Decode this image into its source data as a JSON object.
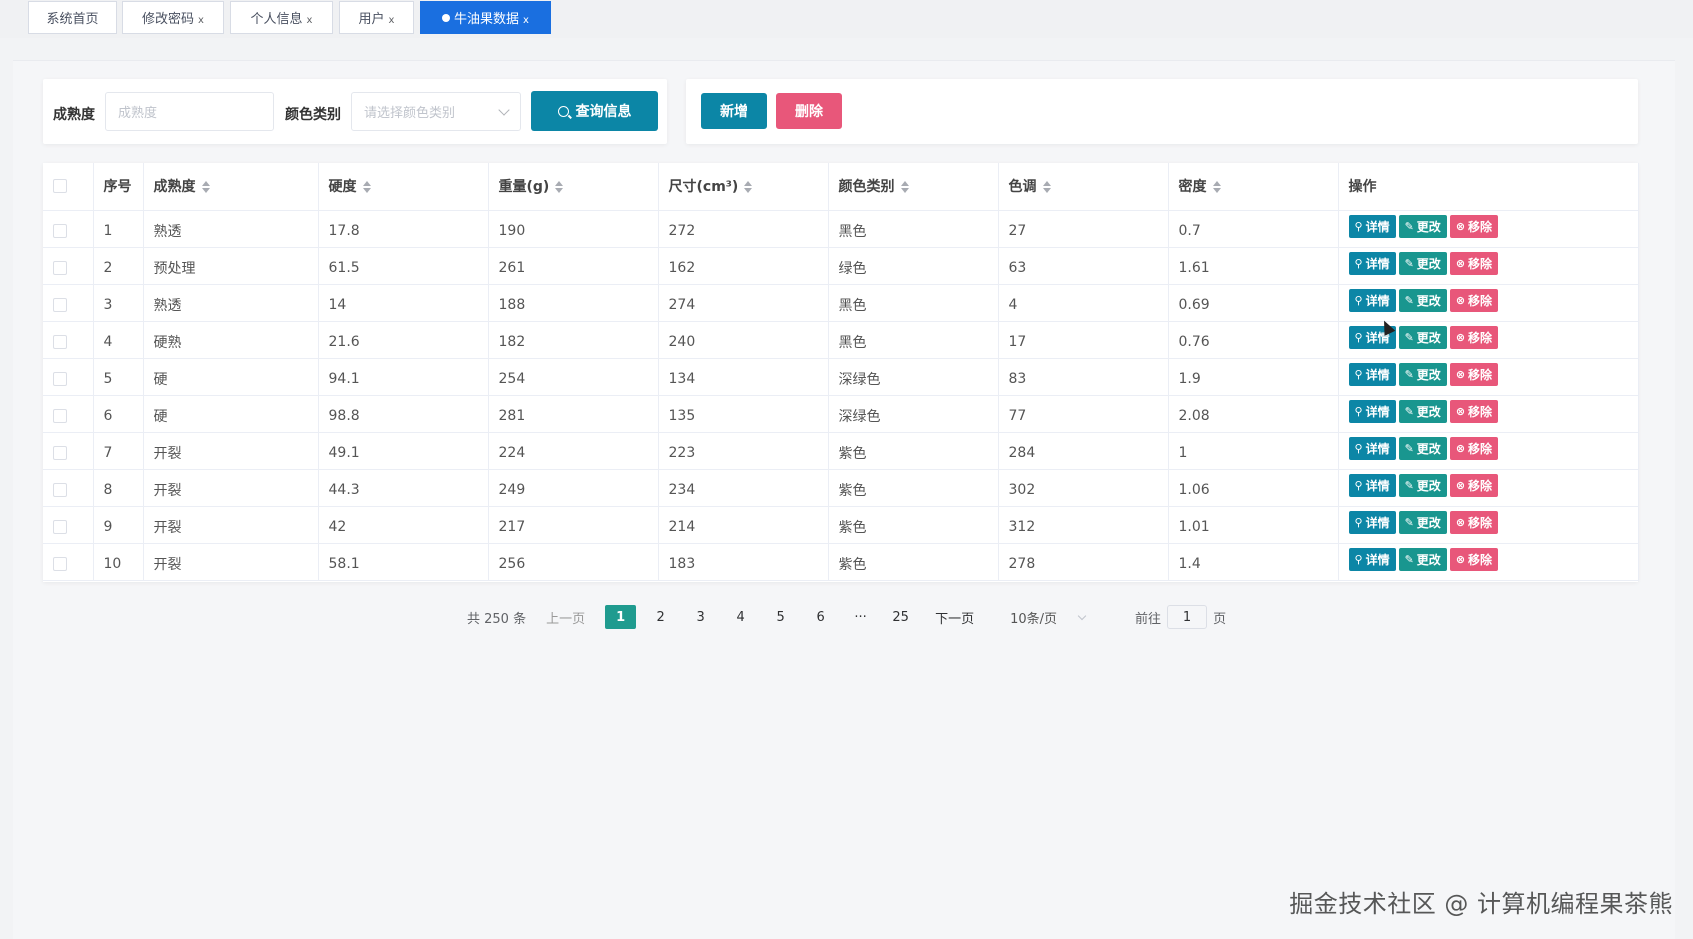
{
  "tabs": [
    {
      "label": "系统首页",
      "closable": false
    },
    {
      "label": "修改密码",
      "closable": true
    },
    {
      "label": "个人信息",
      "closable": true
    },
    {
      "label": "用户",
      "closable": true
    },
    {
      "label": "牛油果数据",
      "closable": true,
      "active": true
    }
  ],
  "tab_close_glyph": "x",
  "search": {
    "ripeness_label": "成熟度",
    "ripeness_placeholder": "成熟度",
    "color_label": "颜色类别",
    "color_placeholder": "请选择颜色类别",
    "query_button": "查询信息"
  },
  "actions": {
    "add_button": "新增",
    "delete_button": "删除"
  },
  "table": {
    "headers": {
      "index": "序号",
      "ripeness": "成熟度",
      "hardness": "硬度",
      "weight": "重量(g)",
      "size": "尺寸(cm³)",
      "color": "颜色类别",
      "hue": "色调",
      "density": "密度",
      "ops": "操作"
    },
    "op_labels": {
      "detail": "详情",
      "edit": "更改",
      "remove": "移除"
    },
    "rows": [
      {
        "index": "1",
        "ripeness": "熟透",
        "hardness": "17.8",
        "weight": "190",
        "size": "272",
        "color": "黑色",
        "hue": "27",
        "density": "0.7"
      },
      {
        "index": "2",
        "ripeness": "预处理",
        "hardness": "61.5",
        "weight": "261",
        "size": "162",
        "color": "绿色",
        "hue": "63",
        "density": "1.61"
      },
      {
        "index": "3",
        "ripeness": "熟透",
        "hardness": "14",
        "weight": "188",
        "size": "274",
        "color": "黑色",
        "hue": "4",
        "density": "0.69"
      },
      {
        "index": "4",
        "ripeness": "硬熟",
        "hardness": "21.6",
        "weight": "182",
        "size": "240",
        "color": "黑色",
        "hue": "17",
        "density": "0.76"
      },
      {
        "index": "5",
        "ripeness": "硬",
        "hardness": "94.1",
        "weight": "254",
        "size": "134",
        "color": "深绿色",
        "hue": "83",
        "density": "1.9"
      },
      {
        "index": "6",
        "ripeness": "硬",
        "hardness": "98.8",
        "weight": "281",
        "size": "135",
        "color": "深绿色",
        "hue": "77",
        "density": "2.08"
      },
      {
        "index": "7",
        "ripeness": "开裂",
        "hardness": "49.1",
        "weight": "224",
        "size": "223",
        "color": "紫色",
        "hue": "284",
        "density": "1"
      },
      {
        "index": "8",
        "ripeness": "开裂",
        "hardness": "44.3",
        "weight": "249",
        "size": "234",
        "color": "紫色",
        "hue": "302",
        "density": "1.06"
      },
      {
        "index": "9",
        "ripeness": "开裂",
        "hardness": "42",
        "weight": "217",
        "size": "214",
        "color": "紫色",
        "hue": "312",
        "density": "1.01"
      },
      {
        "index": "10",
        "ripeness": "开裂",
        "hardness": "58.1",
        "weight": "256",
        "size": "183",
        "color": "紫色",
        "hue": "278",
        "density": "1.4"
      }
    ]
  },
  "pagination": {
    "total": "共 250 条",
    "prev": "上一页",
    "pages": [
      "1",
      "2",
      "3",
      "4",
      "5",
      "6",
      "···",
      "25"
    ],
    "current": "1",
    "next": "下一页",
    "page_size": "10条/页",
    "goto_label": "前往",
    "goto_value": "1",
    "goto_suffix": "页"
  },
  "watermark": "掘金技术社区 @ 计算机编程果茶熊",
  "colors": {
    "primary": "#0c86a6",
    "edit": "#19968f",
    "danger": "#e8577a",
    "active_tab": "#1a6fe0",
    "active_page": "#1f9b8f"
  }
}
